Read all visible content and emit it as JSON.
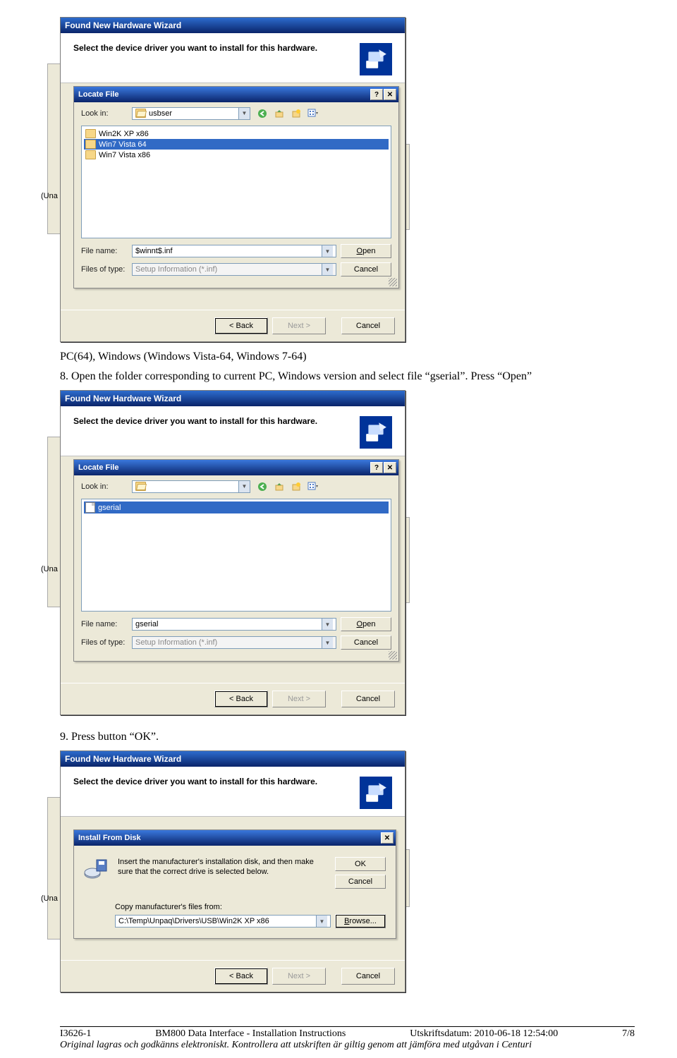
{
  "dlg1": {
    "wizard_title": "Found New Hardware Wizard",
    "heading": "Select the device driver you want to install for this hardware.",
    "locate_title": "Locate File",
    "look_in_label": "Look in:",
    "look_in_value": "usbser",
    "files": [
      {
        "name": "Win2K XP x86",
        "selected": false,
        "type": "folder"
      },
      {
        "name": "Win7 Vista 64",
        "selected": true,
        "type": "folder"
      },
      {
        "name": "Win7 Vista x86",
        "selected": false,
        "type": "folder"
      }
    ],
    "file_name_label": "File name:",
    "file_name_value": "$winnt$.inf",
    "files_of_type_label": "Files of type:",
    "files_of_type_value": "Setup Information (*.inf)",
    "open": "Open",
    "cancel": "Cancel",
    "back": "< Back",
    "next": "Next >",
    "cancel2": "Cancel",
    "una": "(Una"
  },
  "caption1": "PC(64), Windows (Windows Vista-64, Windows 7-64)",
  "caption2": "8. Open the folder corresponding to current PC, Windows version and  select file “gserial”. Press “Open”",
  "dlg2": {
    "wizard_title": "Found New Hardware Wizard",
    "heading": "Select the device driver you want to install for this hardware.",
    "locate_title": "Locate File",
    "look_in_label": "Look in:",
    "look_in_value": "",
    "files": [
      {
        "name": "gserial",
        "selected": true,
        "type": "file"
      }
    ],
    "file_name_label": "File name:",
    "file_name_value": "gserial",
    "files_of_type_label": "Files of type:",
    "files_of_type_value": "Setup Information (*.inf)",
    "open": "Open",
    "cancel": "Cancel",
    "back": "< Back",
    "next": "Next >",
    "cancel2": "Cancel",
    "una": "(Una"
  },
  "caption3": "9. Press button “OK”.",
  "dlg3": {
    "wizard_title": "Found New Hardware Wizard",
    "heading": "Select the device driver you want to install for this hardware.",
    "install_title": "Install From Disk",
    "install_text": "Insert the manufacturer's installation disk, and then make sure that the correct drive is selected below.",
    "ok": "OK",
    "cancel": "Cancel",
    "copy_label": "Copy manufacturer's files from:",
    "copy_value": "C:\\Temp\\Unpaq\\Drivers\\USB\\Win2K XP x86",
    "browse": "Browse...",
    "back": "< Back",
    "next": "Next >",
    "cancel2": "Cancel",
    "una": "(Una"
  },
  "footer": {
    "doc_id": "I3626-1",
    "doc_title": "BM800 Data Interface - Installation Instructions",
    "print_label": "Utskriftsdatum: 2010-06-18 12:54:00",
    "page": "7/8",
    "disclaimer": "Original lagras och godkänns elektroniskt. Kontrollera att utskriften är giltig genom att jämföra med utgåvan i Centuri"
  }
}
